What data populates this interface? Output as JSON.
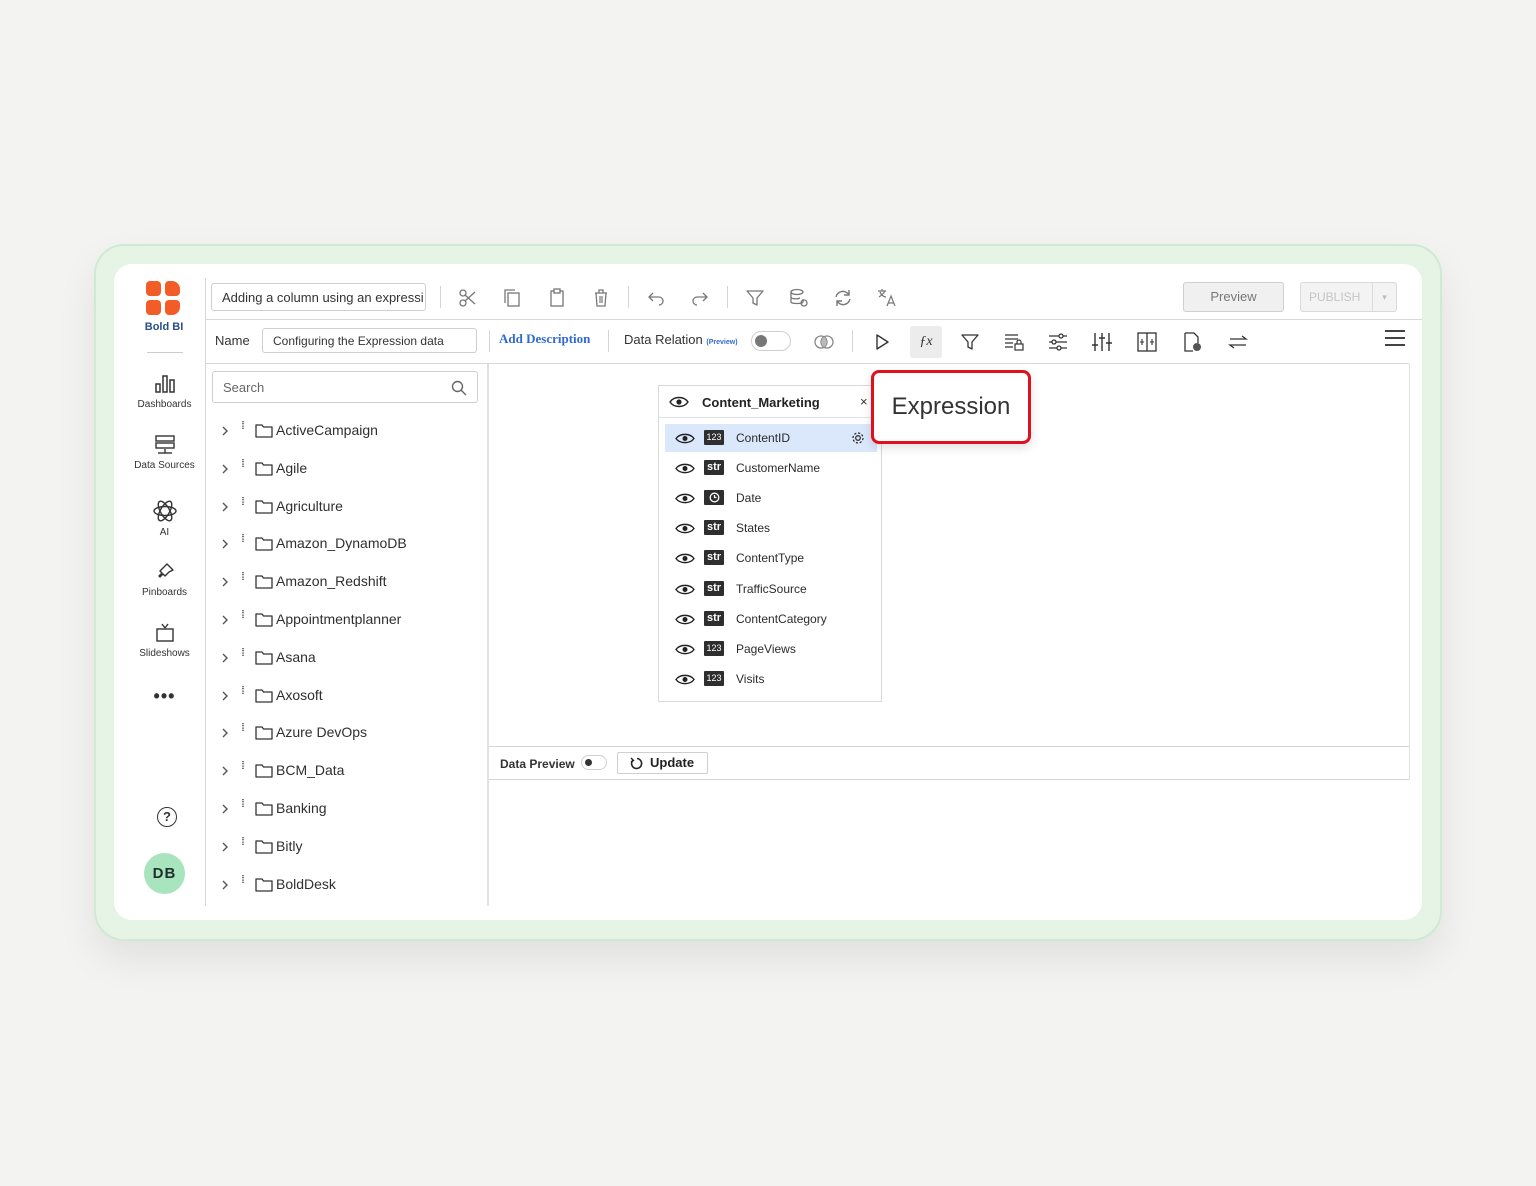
{
  "app": {
    "brand": "Bold BI",
    "title_input_value": "Adding a column using an expressi"
  },
  "nav": {
    "items": [
      {
        "label": "Dashboards",
        "icon": "bar-chart-icon"
      },
      {
        "label": "Data Sources",
        "icon": "database-icon"
      },
      {
        "label": "AI",
        "icon": "atom-icon"
      },
      {
        "label": "Pinboards",
        "icon": "pin-icon"
      },
      {
        "label": "Slideshows",
        "icon": "tv-icon"
      }
    ],
    "more": "•••",
    "help": "?",
    "avatar": "DB"
  },
  "toolbar": {
    "preview_label": "Preview",
    "publish_label": "PUBLISH"
  },
  "datasource": {
    "name_label": "Name",
    "name_value": "Configuring the Expression data",
    "add_description": "Add Description",
    "data_relation_label": "Data Relation",
    "data_relation_tag": "(Preview)",
    "fx_label": "ƒx"
  },
  "search": {
    "placeholder": "Search"
  },
  "tree": [
    "ActiveCampaign",
    "Agile",
    "Agriculture",
    "Amazon_DynamoDB",
    "Amazon_Redshift",
    "Appointmentplanner",
    "Asana",
    "Axosoft",
    "Azure DevOps",
    "BCM_Data",
    "Banking",
    "Bitly",
    "BoldDesk"
  ],
  "table": {
    "name": "Content_Marketing",
    "close": "×",
    "columns": [
      {
        "name": "ContentID",
        "type": "123"
      },
      {
        "name": "CustomerName",
        "type": "str"
      },
      {
        "name": "Date",
        "type": "date"
      },
      {
        "name": "States",
        "type": "str"
      },
      {
        "name": "ContentType",
        "type": "str"
      },
      {
        "name": "TrafficSource",
        "type": "str"
      },
      {
        "name": "ContentCategory",
        "type": "str"
      },
      {
        "name": "PageViews",
        "type": "123"
      },
      {
        "name": "Visits",
        "type": "123"
      }
    ]
  },
  "callout": {
    "text": "Expression",
    "border_color": "#e0101d"
  },
  "data_preview": {
    "label": "Data Preview",
    "update_label": "Update"
  },
  "colors": {
    "brand": "#f25c26",
    "accent": "#2f6bcf",
    "selected_row": "#dbe7fb"
  }
}
